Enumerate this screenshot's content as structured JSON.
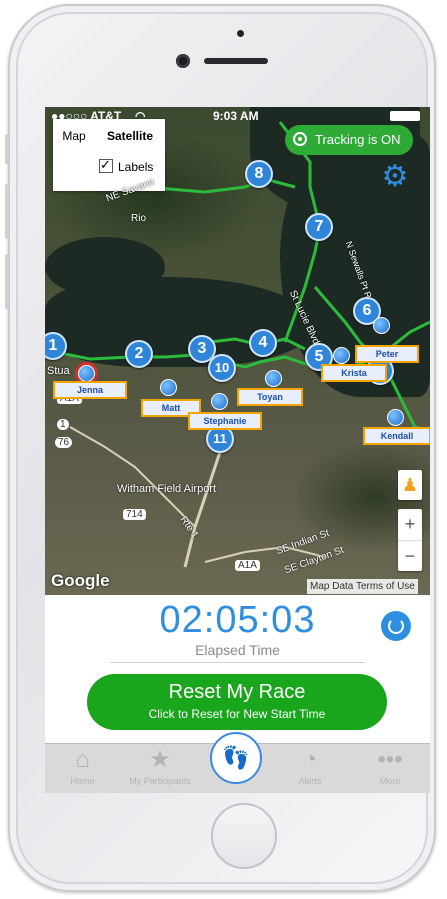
{
  "status_bar": {
    "carrier": "●●○○○ AT&T",
    "wifi": "wifi-icon",
    "time": "9:03 AM"
  },
  "map_controls": {
    "map_label": "Map",
    "satellite_label": "Satellite",
    "labels_label": "Labels",
    "labels_checked": true,
    "tracking_label": "Tracking is ON",
    "zoom_in": "+",
    "zoom_out": "−"
  },
  "map_labels": {
    "rio": "Rio",
    "airport": "Witham Field Airport",
    "street1": "NE Savann",
    "street2": "St Lucie Blvd",
    "street3": "SE Indian St",
    "street4": "SE Clayton St",
    "street5": "Rte 1",
    "road714": "714",
    "road76": "76",
    "roadA1A": "A1A",
    "road1": "1",
    "stuart": "Stua",
    "dr": "N Sewalls Pt Rd",
    "google": "Google",
    "attribution": "Map Data   Terms of Use"
  },
  "checkpoints": [
    "1",
    "2",
    "3",
    "4",
    "5",
    "6",
    "6",
    "7",
    "8",
    "10",
    "11"
  ],
  "participants": [
    "Jenna",
    "Matt",
    "Stephanie",
    "Toyan",
    "Krista",
    "Peter",
    "Kendall"
  ],
  "timer": {
    "value": "02:05:03",
    "label": "Elapsed Time"
  },
  "reset": {
    "title": "Reset My Race",
    "subtitle": "Click to Reset for New Start Time"
  },
  "tabs": [
    {
      "label": "Home",
      "icon": "home-icon"
    },
    {
      "label": "My Participants",
      "icon": "star-plus-icon"
    },
    {
      "label": "",
      "icon": "footprints-icon"
    },
    {
      "label": "Alerts",
      "icon": "alerts-icon"
    },
    {
      "label": "More",
      "icon": "more-icon"
    }
  ],
  "colors": {
    "accent": "#2e8fe0",
    "tracking": "#2eaa36",
    "reset": "#19a51c",
    "route": "#2bbb3a",
    "tag_border": "#f2a500"
  }
}
